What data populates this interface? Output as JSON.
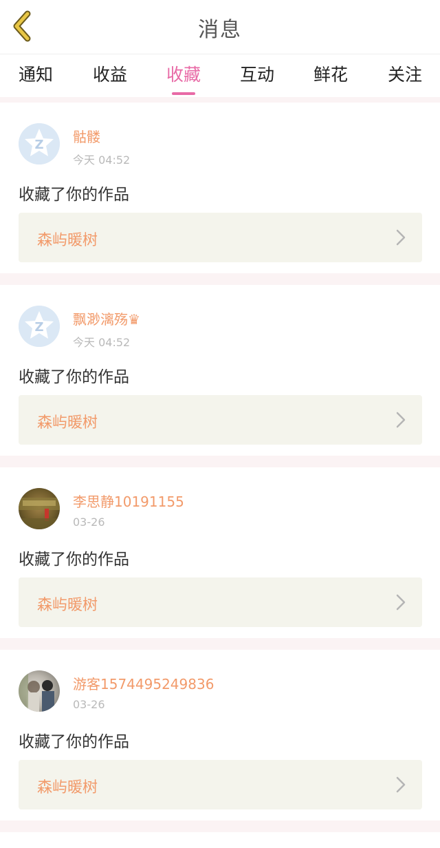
{
  "header": {
    "title": "消息",
    "back_icon": "chevron-left-icon",
    "accent_color": "#e8c645"
  },
  "tabs": [
    {
      "label": "通知",
      "active": false
    },
    {
      "label": "收益",
      "active": false
    },
    {
      "label": "收藏",
      "active": true
    },
    {
      "label": "互动",
      "active": false
    },
    {
      "label": "鲜花",
      "active": false
    },
    {
      "label": "关注",
      "active": false
    }
  ],
  "colors": {
    "active_tab": "#e86aa6",
    "name": "#f29a6a",
    "work_box_bg": "#f4f4ec"
  },
  "messages": [
    {
      "username": "骷髅",
      "time": "今天 04:52",
      "action": "收藏了你的作品",
      "work_title": "森屿暖树",
      "avatar": "default-avatar"
    },
    {
      "username": "飘渺漓殇♛",
      "time": "今天 04:52",
      "action": "收藏了你的作品",
      "work_title": "森屿暖树",
      "avatar": "default-avatar"
    },
    {
      "username": "李思静10191155",
      "time": "03-26",
      "action": "收藏了你的作品",
      "work_title": "森屿暖树",
      "avatar": "photo-avatar"
    },
    {
      "username": "游客1574495249836",
      "time": "03-26",
      "action": "收藏了你的作品",
      "work_title": "森屿暖树",
      "avatar": "photo-avatar"
    }
  ]
}
